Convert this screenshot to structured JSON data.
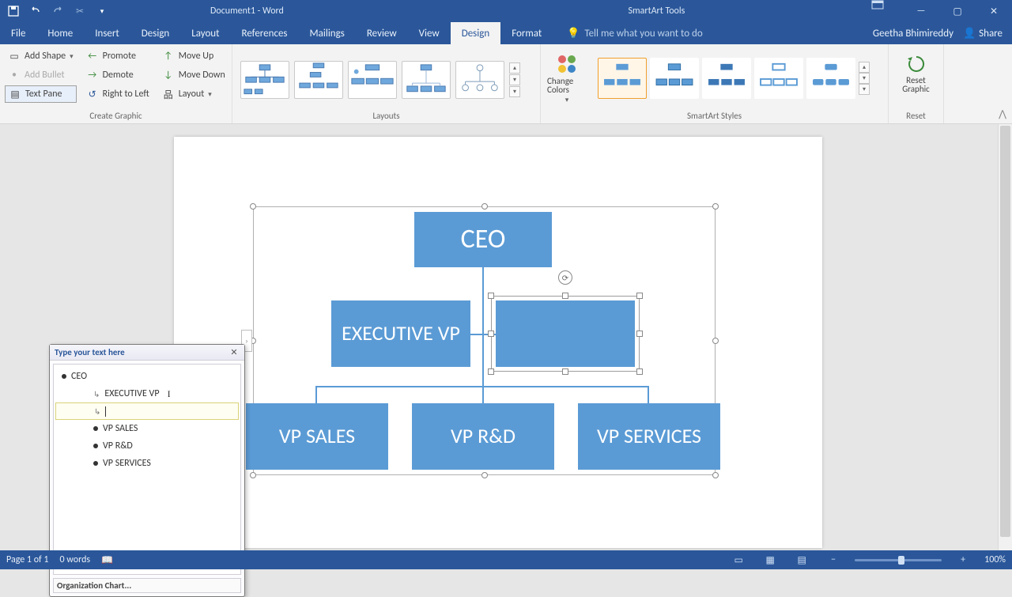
{
  "titlebar": {
    "document": "Document1 - Word",
    "context": "SmartArt Tools"
  },
  "tabs": [
    "File",
    "Home",
    "Insert",
    "Design",
    "Layout",
    "References",
    "Mailings",
    "Review",
    "View",
    "Design",
    "Format"
  ],
  "active_tab_index": 9,
  "tell_me": "Tell me what you want to do",
  "user": "Geetha Bhimireddy",
  "share": "Share",
  "ribbon": {
    "create": {
      "add_shape": "Add Shape",
      "add_bullet": "Add Bullet",
      "text_pane": "Text Pane",
      "promote": "Promote",
      "demote": "Demote",
      "rtl": "Right to Left",
      "move_up": "Move Up",
      "move_down": "Move Down",
      "layout": "Layout",
      "label": "Create Graphic"
    },
    "layouts_label": "Layouts",
    "change_colors": "Change Colors",
    "styles_label": "SmartArt Styles",
    "reset": "Reset Graphic",
    "reset_label": "Reset"
  },
  "textpane": {
    "title": "Type your text here",
    "items": [
      "CEO",
      "EXECUTIVE VP",
      "",
      "VP SALES",
      "VP R&D",
      "VP SERVICES"
    ],
    "footer": "Organization Chart..."
  },
  "chart_data": {
    "type": "org-chart",
    "root": {
      "label": "CEO",
      "children": [
        {
          "label": "EXECUTIVE VP",
          "assistant": true
        },
        {
          "label": "",
          "assistant": true,
          "selected": true
        },
        {
          "label": "VP SALES"
        },
        {
          "label": "VP R&D"
        },
        {
          "label": "VP SERVICES"
        }
      ]
    },
    "node_fill": "#5b9bd5",
    "node_text": "#ffffff"
  },
  "status": {
    "page": "Page 1 of 1",
    "words": "0 words",
    "zoom": "100%"
  }
}
